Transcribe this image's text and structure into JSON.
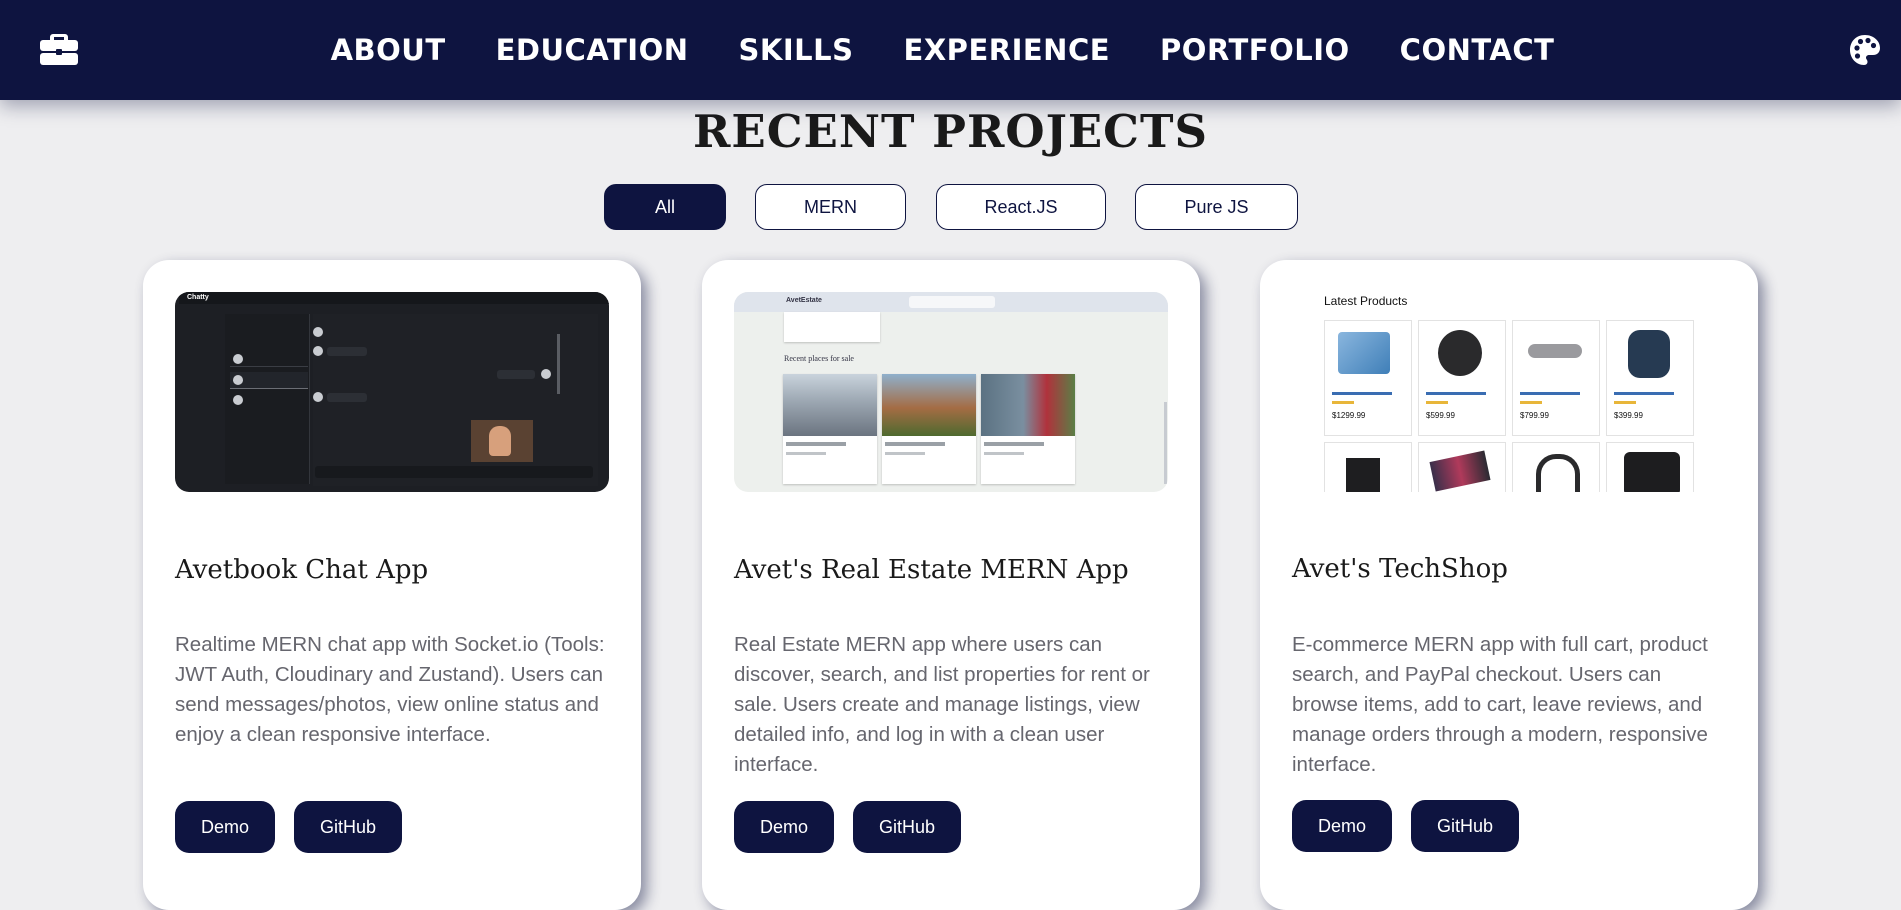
{
  "nav": {
    "links": [
      "ABOUT",
      "EDUCATION",
      "SKILLS",
      "EXPERIENCE",
      "PORTFOLIO",
      "CONTACT"
    ]
  },
  "section": {
    "title": "RECENT PROJECTS"
  },
  "filters": [
    "All",
    "MERN",
    "React.JS",
    "Pure JS"
  ],
  "cards": [
    {
      "title": "Avetbook Chat App",
      "description": "Realtime MERN chat app with Socket.io (Tools: JWT Auth, Cloudinary and Zustand). Users can send messages/photos, view online status and enjoy a clean responsive interface.",
      "demo": "Demo",
      "github": "GitHub",
      "thumb": {
        "app_name": "Chatty"
      }
    },
    {
      "title": "Avet's Real Estate MERN App",
      "description": "Real Estate MERN app where users can discover, search, and list properties for rent or sale. Users create and manage listings, view detailed info, and log in with a clean user interface.",
      "demo": "Demo",
      "github": "GitHub",
      "thumb": {
        "brand": "AvetEstate",
        "heading": "Recent places for sale"
      }
    },
    {
      "title": "Avet's TechShop",
      "description": "E-commerce MERN app with full cart, product search, and PayPal checkout. Users can browse items, add to cart, leave reviews, and manage orders through a modern, responsive interface.",
      "demo": "Demo",
      "github": "GitHub",
      "thumb": {
        "heading": "Latest Products",
        "prices": [
          "$1299.99",
          "$599.99",
          "$799.99",
          "$399.99"
        ]
      }
    }
  ],
  "colors": {
    "navy": "#0e1440",
    "page_bg": "#eeeef0",
    "card_bg": "#ffffff",
    "body_text": "#66666e"
  },
  "icons": [
    "briefcase-icon",
    "palette-icon"
  ]
}
